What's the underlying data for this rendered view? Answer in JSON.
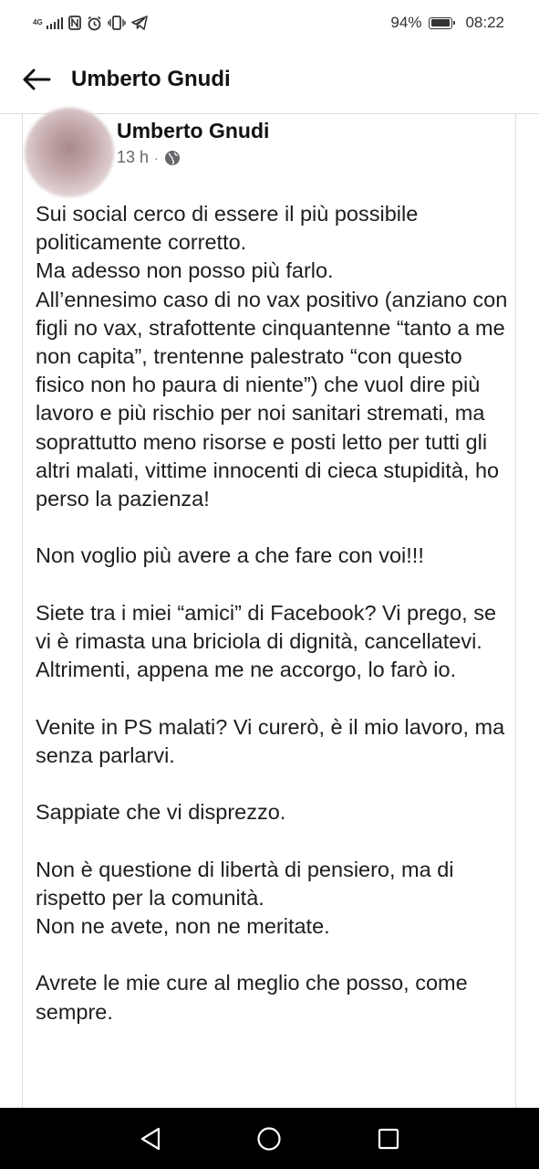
{
  "status_bar": {
    "network_tag": "4G",
    "battery_percent": "94%",
    "time": "08:22",
    "icons": [
      "signal-icon",
      "nfc-icon",
      "alarm-icon",
      "vibrate-icon",
      "telegram-icon",
      "battery-icon"
    ]
  },
  "header": {
    "title": "Umberto Gnudi",
    "back_icon": "back-arrow-icon"
  },
  "post": {
    "author": "Umberto Gnudi",
    "time": "13 h",
    "separator": "·",
    "privacy_icon": "globe-icon",
    "paragraphs": [
      "Sui social cerco di essere il più possibile politicamente corretto.\nMa adesso non posso più farlo.\nAll’ennesimo caso di no vax positivo (anziano con figli no vax, strafottente cinquantenne “tanto a me non capita”, trentenne palestrato “con questo fisico non ho paura di niente”) che vuol dire più lavoro e più rischio per noi sanitari stremati, ma soprattutto meno risorse e posti letto per tutti gli altri malati, vittime innocenti di cieca stupidità, ho perso la pazienza!",
      "Non voglio più avere a che fare con voi!!!",
      "Siete tra i miei “amici” di Facebook? Vi prego, se vi è rimasta una briciola di dignità, cancellatevi. Altrimenti, appena me ne accorgo, lo farò io.",
      "Venite in PS malati? Vi curerò, è il mio lavoro, ma senza parlarvi.",
      "Sappiate che vi disprezzo.",
      "Non è questione di libertà di pensiero, ma di rispetto per la comunità.\nNon ne avete, non ne meritate.",
      "Avrete le mie cure al meglio che posso, come sempre."
    ]
  },
  "nav_bar": {
    "buttons": [
      "back-triangle-icon",
      "home-circle-icon",
      "recents-square-icon"
    ]
  }
}
